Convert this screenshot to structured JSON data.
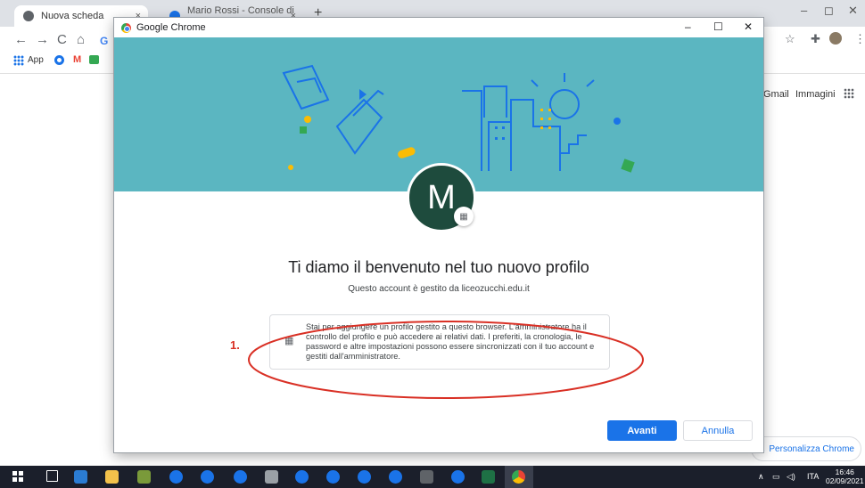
{
  "browser": {
    "tabs": [
      {
        "label": "Nuova scheda",
        "close": "×"
      },
      {
        "label": "Mario Rossi - Console di ammini:",
        "close": "×"
      }
    ],
    "new_tab": "+",
    "window_controls": [
      "–",
      "◻",
      "✕"
    ],
    "nav": [
      "←",
      "→",
      "C",
      "⌂",
      "G"
    ],
    "bookmarks": [
      "App",
      "M"
    ],
    "right_icons": [
      "☆",
      "✚",
      "⋮"
    ],
    "google_links": [
      "Gmail",
      "Immagini"
    ],
    "customize_label": "Personalizza Chrome",
    "customize_icon": "✎"
  },
  "dialog": {
    "title": "Google Chrome",
    "controls": [
      "–",
      "☐",
      "✕"
    ],
    "avatar_letter": "M",
    "badge_icon": "▦",
    "welcome": "Ti diamo il benvenuto nel tuo nuovo profilo",
    "managed_by": "Questo account è gestito da liceozucchi.edu.it",
    "info_icon": "▦",
    "info_text": "Stai per aggiungere un profilo gestito a questo browser. L'amministratore ha il controllo del profilo e può accedere ai relativi dati. I preferiti, la cronologia, le password e altre impostazioni possono essere sincronizzati con il tuo account e gestiti dall'amministratore.",
    "annotation": "1.",
    "next_label": "Avanti",
    "cancel_label": "Annulla",
    "colors": {
      "banner": "#5bb6c1",
      "avatar": "#1e4b3d",
      "primary": "#1a73e8",
      "annotation": "#d93025"
    }
  },
  "taskbar": {
    "tray": [
      "∧",
      "▭",
      "◁)",
      "ITA"
    ],
    "time": "16:46",
    "date": "02/09/2021"
  }
}
